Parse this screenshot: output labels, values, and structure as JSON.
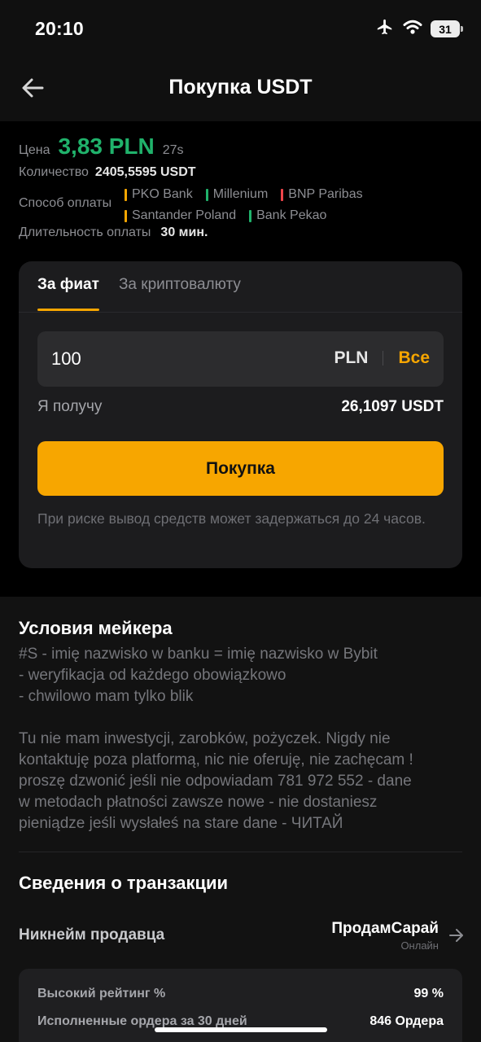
{
  "status_bar": {
    "time": "20:10",
    "battery": "31"
  },
  "header": {
    "title": "Покупка USDT"
  },
  "order": {
    "price_label": "Цена",
    "price": "3,83 PLN",
    "timer": "27s",
    "quantity_label": "Количество",
    "quantity": "2405,5595 USDT",
    "payment_label": "Способ оплаты",
    "payment_methods": [
      {
        "name": "PKO Bank",
        "color": "#f7a600"
      },
      {
        "name": "Millenium",
        "color": "#20b26b"
      },
      {
        "name": "BNP Paribas",
        "color": "#ef454a"
      },
      {
        "name": "Santander Poland",
        "color": "#f7a600"
      },
      {
        "name": "Bank Pekao",
        "color": "#20b26b"
      }
    ],
    "duration_label": "Длительность оплаты",
    "duration": "30 мин."
  },
  "trade": {
    "tabs": [
      {
        "label": "За фиат",
        "active": true
      },
      {
        "label": "За криптовалюту",
        "active": false
      }
    ],
    "amount_value": "100",
    "currency": "PLN",
    "all_label": "Все",
    "receive_label": "Я получу",
    "receive_value": "26,1097 USDT",
    "buy_label": "Покупка",
    "risk_note": "При риске вывод средств может задержаться до 24 часов."
  },
  "maker_terms": {
    "title": "Условия мейкера",
    "lines": [
      "#S - imię nazwisko w banku = imię nazwisko w Bybit",
      "- weryfikacja od każdego obowiązkowo",
      "- chwilowo mam tylko blik",
      "",
      "Tu nie mam inwestycji, zarobków, pożyczek. Nigdy nie",
      "kontaktuję poza platformą, nic nie oferuję, nie zachęcam !",
      "proszę dzwonić jeśli nie odpowiadam     781 972 552 - dane",
      "w metodach płatności zawsze nowe - nie dostaniesz",
      "pieniądze jeśli wysłałeś na stare dane - ЧИТАЙ"
    ]
  },
  "transaction": {
    "title": "Сведения о транзакции",
    "seller_label": "Никнейм продавца",
    "seller_name": "ПродамСарай",
    "seller_status": "Онлайн",
    "stats": [
      {
        "label": "Высокий рейтинг %",
        "value": "99 %"
      },
      {
        "label": "Исполненные ордера за 30 дней",
        "value": "846 Ордера"
      }
    ]
  }
}
